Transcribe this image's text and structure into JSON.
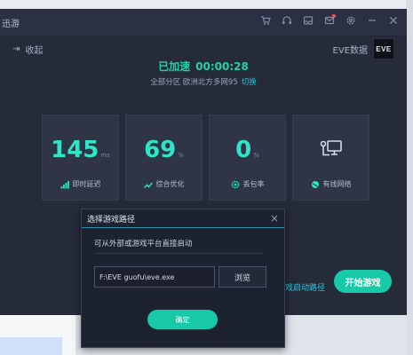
{
  "app": {
    "title": "迅游",
    "collapse_label": "收起",
    "eve_data_label": "EVE数据",
    "eve_logo_text": "EVE"
  },
  "acceleration": {
    "status": "已加速",
    "time": "00:00:28",
    "region_info": "全部分区 欧洲北方多网95",
    "switch_label": "切换"
  },
  "stats": [
    {
      "value": "145",
      "unit": "ms",
      "label": "即时延迟",
      "icon": "signal-bars-icon"
    },
    {
      "value": "69",
      "unit": "%",
      "label": "综合优化",
      "icon": "trend-up-icon"
    },
    {
      "value": "0",
      "unit": "%",
      "label": "丢包率",
      "icon": "gear-icon"
    },
    {
      "value": "",
      "unit": "",
      "label": "有线网络",
      "icon": "network-icon"
    }
  ],
  "actions": {
    "start_game": "开始游戏",
    "custom_path": "游戏启动路径"
  },
  "dialog": {
    "title": "选择游戏路径",
    "description": "可从外部或游戏平台直接启动",
    "path_value": "F:\\EVE guofu\\eve.exe",
    "browse_label": "浏览",
    "confirm_label": "确定"
  },
  "colors": {
    "accent": "#17c9a6",
    "value": "#2ee5c5",
    "link": "#22c7d8"
  }
}
